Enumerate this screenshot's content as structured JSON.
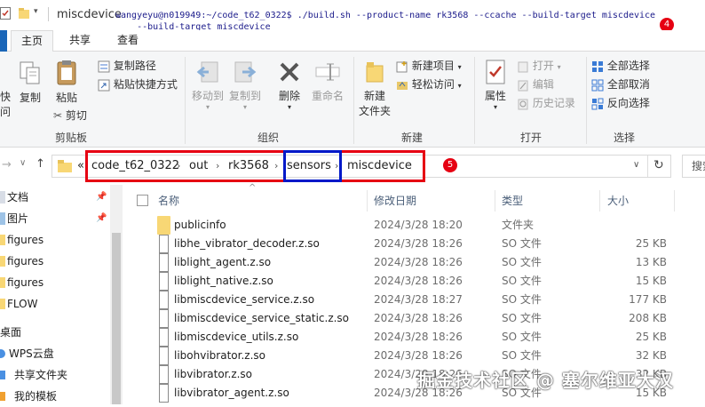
{
  "window": {
    "title": "miscdevice",
    "command_line1": "wangyeyu@n019949:~/code_t62_0322$ ./build.sh --product-name rk3568 --ccache --build-target miscdevice",
    "command_line2": "    --build-target miscdevice"
  },
  "tabs": [
    "主页",
    "共享",
    "查看"
  ],
  "ribbon": {
    "partial_left_1": "快",
    "partial_left_2": "问",
    "copy": "复制",
    "paste": "粘贴",
    "copy_path": "复制路径",
    "paste_shortcut": "粘贴快捷方式",
    "cut": "剪切",
    "clipboard_group": "剪贴板",
    "move_to": "移动到",
    "copy_to": "复制到",
    "delete": "删除",
    "rename": "重命名",
    "organize_group": "组织",
    "new_folder_1": "新建",
    "new_folder_2": "文件夹",
    "new_item": "新建项目",
    "easy_access": "轻松访问",
    "new_group": "新建",
    "properties": "属性",
    "open": "打开",
    "edit": "编辑",
    "history": "历史记录",
    "open_group": "打开",
    "select_all": "全部选择",
    "select_none": "全部取消",
    "invert_selection": "反向选择",
    "select_group": "选择"
  },
  "address": {
    "overflow": "«",
    "crumbs": [
      "code_t62_0322",
      "out",
      "rk3568",
      "sensors",
      "miscdevice"
    ],
    "search_placeholder": "搜索"
  },
  "sidebar": {
    "items": [
      "文档",
      "图片",
      "figures",
      "figures",
      "figures",
      "FLOW",
      "桌面",
      "WPS云盘",
      "共享文件夹",
      "我的模板"
    ]
  },
  "columns": {
    "name": "名称",
    "date": "修改日期",
    "type": "类型",
    "size": "大小"
  },
  "files": [
    {
      "name": "publicinfo",
      "date": "2024/3/28 18:20",
      "type": "文件夹",
      "size": "",
      "folder": true
    },
    {
      "name": "libhe_vibrator_decoder.z.so",
      "date": "2024/3/28 18:26",
      "type": "SO 文件",
      "size": "25 KB"
    },
    {
      "name": "liblight_agent.z.so",
      "date": "2024/3/28 18:26",
      "type": "SO 文件",
      "size": "13 KB"
    },
    {
      "name": "liblight_native.z.so",
      "date": "2024/3/28 18:26",
      "type": "SO 文件",
      "size": "15 KB"
    },
    {
      "name": "libmiscdevice_service.z.so",
      "date": "2024/3/28 18:27",
      "type": "SO 文件",
      "size": "177 KB"
    },
    {
      "name": "libmiscdevice_service_static.z.so",
      "date": "2024/3/28 18:26",
      "type": "SO 文件",
      "size": "208 KB"
    },
    {
      "name": "libmiscdevice_utils.z.so",
      "date": "2024/3/28 18:26",
      "type": "SO 文件",
      "size": "25 KB"
    },
    {
      "name": "libohvibrator.z.so",
      "date": "2024/3/28 18:26",
      "type": "SO 文件",
      "size": "32 KB"
    },
    {
      "name": "libvibrator.z.so",
      "date": "2024/3/28 18:26",
      "type": "SO 文件",
      "size": "32 KB"
    },
    {
      "name": "libvibrator_agent.z.so",
      "date": "2024/3/28 18:26",
      "type": "SO 文件",
      "size": "15 KB"
    }
  ],
  "annotations": {
    "badge_cmd": "4",
    "badge_path": "5"
  },
  "watermark": "掘金技术社区 @ 塞尔维亚大汉",
  "colors": {
    "annotation_red": "#e60012",
    "annotation_blue": "#0018c8",
    "folder": "#f8d775"
  }
}
